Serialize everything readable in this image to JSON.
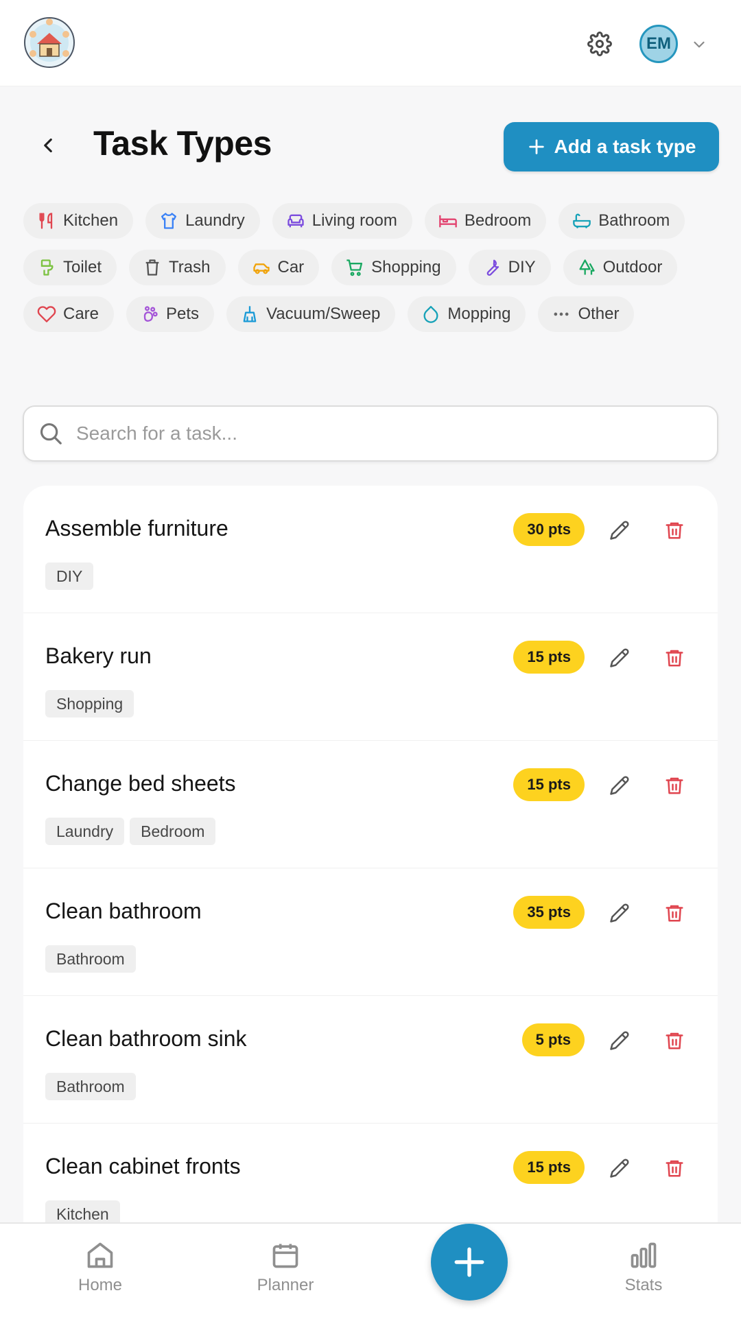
{
  "header": {
    "title": "Task Types",
    "add_button_label": "Add a task type",
    "avatar_initials": "EM"
  },
  "categories": [
    {
      "label": "Kitchen",
      "icon": "utensils-icon",
      "color": "#e0454f"
    },
    {
      "label": "Laundry",
      "icon": "shirt-icon",
      "color": "#3b82f6"
    },
    {
      "label": "Living room",
      "icon": "sofa-icon",
      "color": "#7c4dde"
    },
    {
      "label": "Bedroom",
      "icon": "bed-icon",
      "color": "#e2436f"
    },
    {
      "label": "Bathroom",
      "icon": "bathtub-icon",
      "color": "#17a2b8"
    },
    {
      "label": "Toilet",
      "icon": "toilet-icon",
      "color": "#7cc242"
    },
    {
      "label": "Trash",
      "icon": "trash-icon",
      "color": "#555555"
    },
    {
      "label": "Car",
      "icon": "car-icon",
      "color": "#f0a30a"
    },
    {
      "label": "Shopping",
      "icon": "cart-icon",
      "color": "#19a861"
    },
    {
      "label": "DIY",
      "icon": "wrench-icon",
      "color": "#7c4dde"
    },
    {
      "label": "Outdoor",
      "icon": "trees-icon",
      "color": "#19a861"
    },
    {
      "label": "Care",
      "icon": "heart-icon",
      "color": "#e0454f"
    },
    {
      "label": "Pets",
      "icon": "paw-icon",
      "color": "#a455d8"
    },
    {
      "label": "Vacuum/Sweep",
      "icon": "broom-icon",
      "color": "#1a9ad6"
    },
    {
      "label": "Mopping",
      "icon": "droplet-icon",
      "color": "#17a2b8"
    },
    {
      "label": "Other",
      "icon": "more-dots-icon",
      "color": "#666666"
    }
  ],
  "search": {
    "placeholder": "Search for a task..."
  },
  "tasks": [
    {
      "title": "Assemble furniture",
      "points": "30 pts",
      "tags": [
        "DIY"
      ]
    },
    {
      "title": "Bakery run",
      "points": "15 pts",
      "tags": [
        "Shopping"
      ]
    },
    {
      "title": "Change bed sheets",
      "points": "15 pts",
      "tags": [
        "Laundry",
        "Bedroom"
      ]
    },
    {
      "title": "Clean bathroom",
      "points": "35 pts",
      "tags": [
        "Bathroom"
      ]
    },
    {
      "title": "Clean bathroom sink",
      "points": "5 pts",
      "tags": [
        "Bathroom"
      ]
    },
    {
      "title": "Clean cabinet fronts",
      "points": "15 pts",
      "tags": [
        "Kitchen"
      ]
    }
  ],
  "nav": {
    "home": "Home",
    "planner": "Planner",
    "stats": "Stats"
  },
  "colors": {
    "accent": "#1f8fc2",
    "points_badge": "#fdd21f",
    "delete": "#e0454f"
  }
}
